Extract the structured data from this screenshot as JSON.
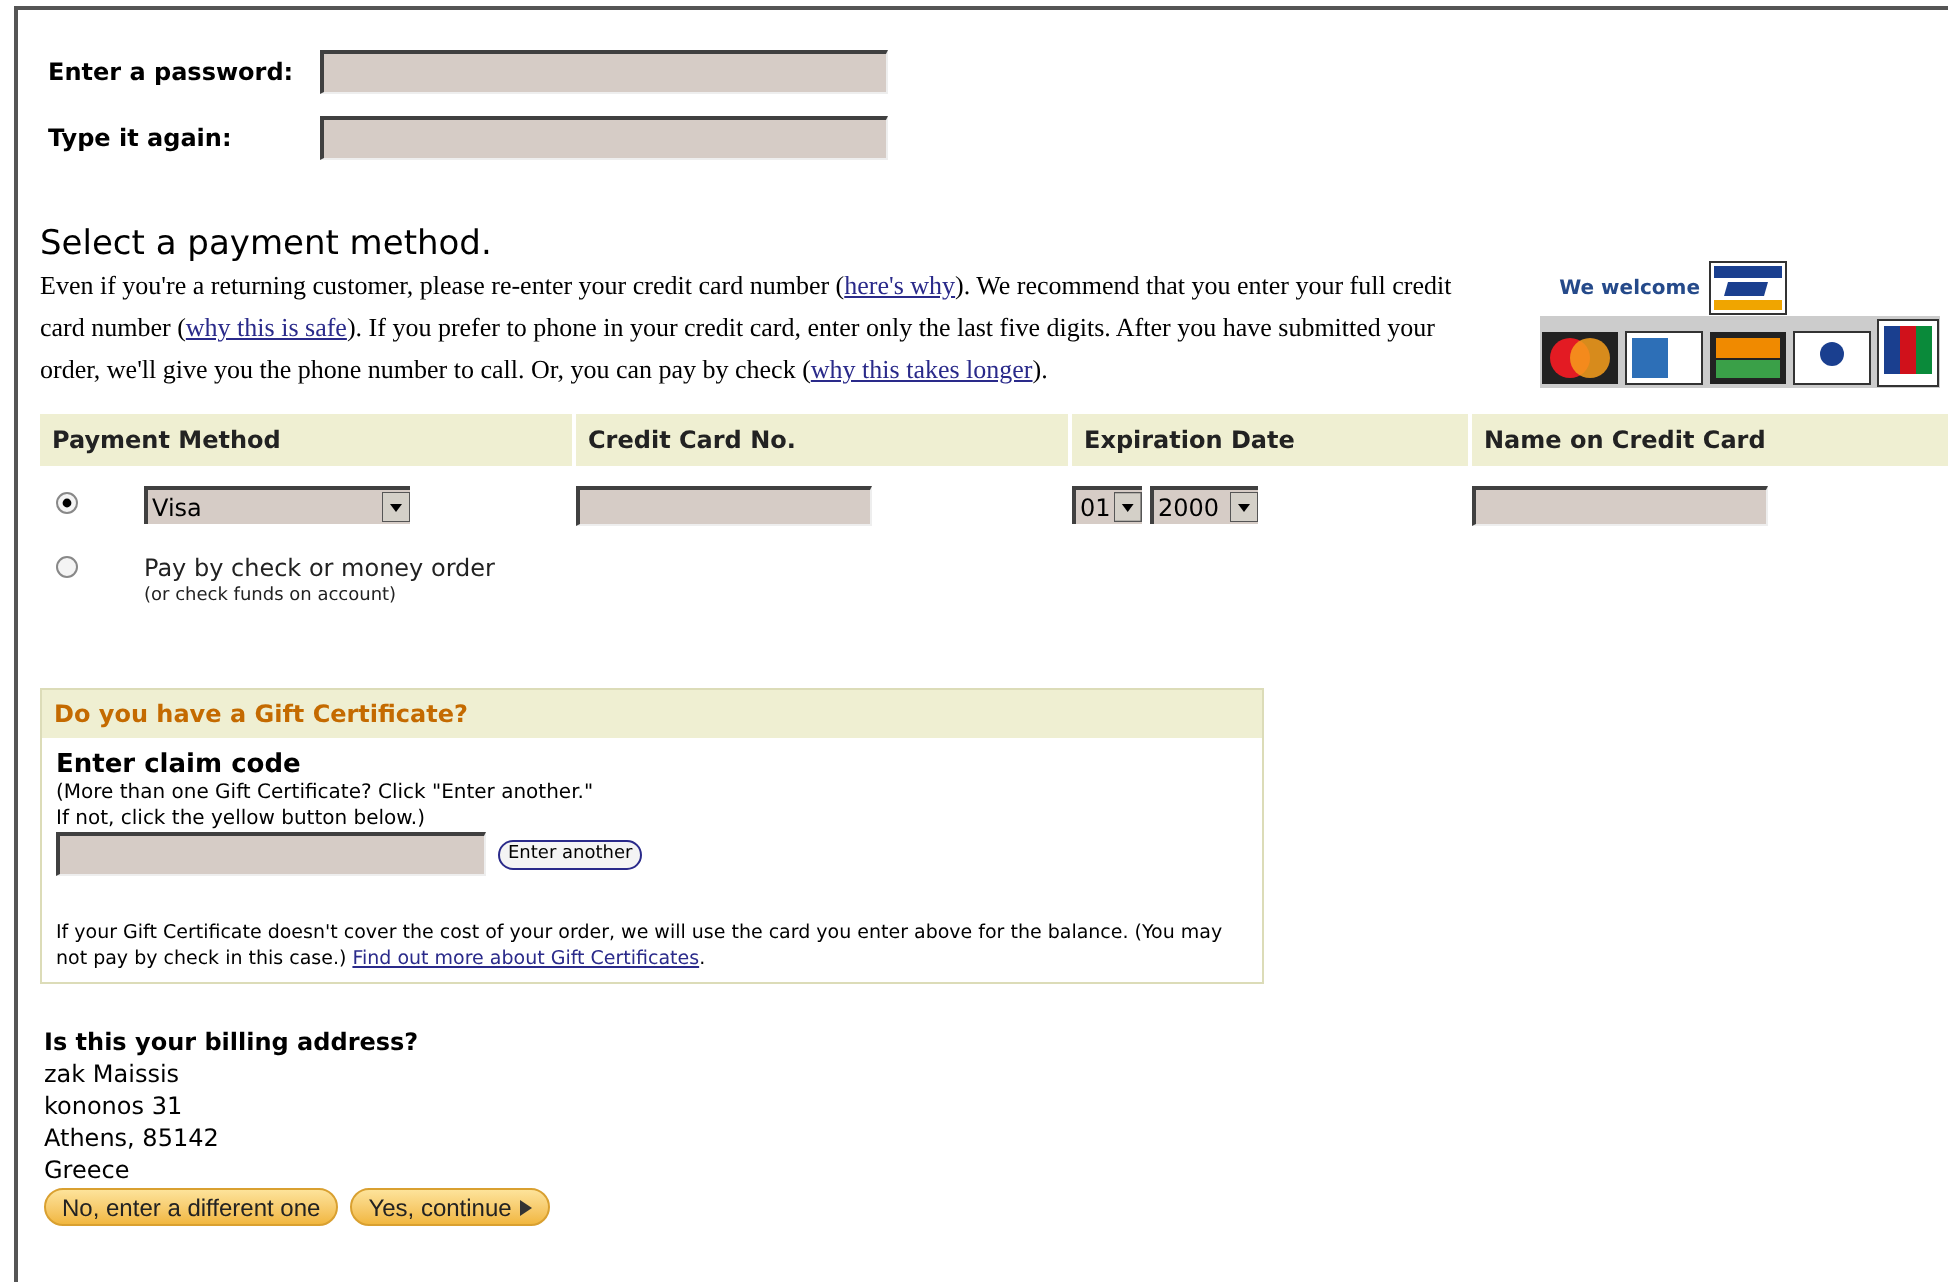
{
  "password_fields": [
    {
      "label": "Enter a password:"
    },
    {
      "label": "Type it again:"
    }
  ],
  "payment": {
    "title": "Select a payment method.",
    "intro": [
      {
        "text": "Even if you're a returning customer, please re-enter your credit card number (",
        "kind": "text"
      },
      {
        "text": "here's why",
        "kind": "link"
      },
      {
        "text": "). We recommend that you enter your full credit card number (",
        "kind": "text"
      },
      {
        "text": "why this is safe",
        "kind": "link"
      },
      {
        "text": "). If you prefer to phone in your credit card, enter only the last five digits. After you have submitted your order, we'll give you the phone number to call. Or, you can pay by check (",
        "kind": "text"
      },
      {
        "text": "why this takes longer",
        "kind": "link"
      },
      {
        "text": ").",
        "kind": "text"
      }
    ],
    "cards_banner": "We welcome",
    "columns": [
      "Payment Method",
      "Credit Card No.",
      "Expiration Date",
      "Name on Credit Card"
    ],
    "options": [
      {
        "kind": "card",
        "selected": true,
        "card_type": "Visa",
        "month": "01",
        "year": "2000"
      },
      {
        "kind": "check",
        "selected": false,
        "label": "Pay by check or money order",
        "note": "(or check funds on account)"
      }
    ]
  },
  "gift": {
    "header": "Do you have a Gift Certificate?",
    "title": "Enter claim code",
    "hint": [
      "(More than one Gift Certificate? Click \"Enter another.\"",
      "If not, click the yellow button below.)"
    ],
    "button": "Enter another",
    "note": "If your Gift Certificate doesn't cover the cost of your order, we will use the card you enter above for the balance. (You may not pay by check in this case.)",
    "link": "Find out more about Gift Certificates",
    "after_link": "."
  },
  "billing": {
    "question": "Is this your billing address?",
    "lines": [
      "zak Maissis",
      "kononos 31",
      "Athens, 85142",
      "Greece"
    ],
    "buttons": [
      {
        "label": "No, enter a different one",
        "arrow": false
      },
      {
        "label": "Yes, continue",
        "arrow": true
      }
    ]
  }
}
